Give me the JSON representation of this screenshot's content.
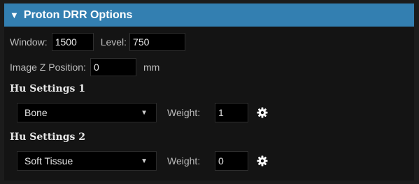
{
  "panel": {
    "title": "Proton DRR Options",
    "collapse_glyph": "▼"
  },
  "window": {
    "label": "Window:",
    "value": "1500"
  },
  "level": {
    "label": "Level:",
    "value": "750"
  },
  "image_z": {
    "label": "Image Z Position:",
    "value": "0",
    "unit": "mm"
  },
  "hu1": {
    "title": "Hu Settings 1",
    "material": "Bone",
    "weight_label": "Weight:",
    "weight_value": "1",
    "settings_icon": "gear-icon"
  },
  "hu2": {
    "title": "Hu Settings 2",
    "material": "Soft Tissue",
    "weight_label": "Weight:",
    "weight_value": "0",
    "settings_icon": "gear-icon"
  },
  "colors": {
    "header_bg": "#337fb1",
    "panel_bg": "#141414",
    "field_bg": "#000000"
  }
}
